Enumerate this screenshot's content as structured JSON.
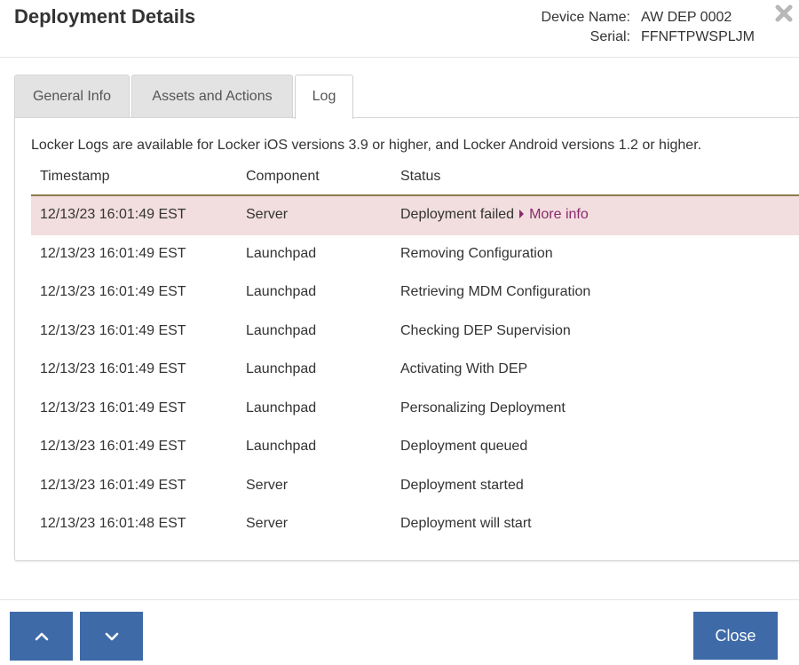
{
  "dialog": {
    "title": "Deployment Details",
    "device_name_label": "Device Name:",
    "device_name": "AW DEP 0002",
    "serial_label": "Serial:",
    "serial": "FFNFTPWSPLJM",
    "close_icon": "close-x-icon"
  },
  "tabs": [
    {
      "label": "General Info",
      "active": false
    },
    {
      "label": "Assets and Actions",
      "active": false
    },
    {
      "label": "Log",
      "active": true
    }
  ],
  "log": {
    "note": "Locker Logs are available for Locker iOS versions 3.9 or higher, and Locker Android versions 1.2 or higher.",
    "columns": [
      "Timestamp",
      "Component",
      "Status"
    ],
    "rows": [
      {
        "timestamp": "12/13/23 16:01:49 EST",
        "component": "Server",
        "status": "Deployment failed",
        "more": "More info",
        "error": true
      },
      {
        "timestamp": "12/13/23 16:01:49 EST",
        "component": "Launchpad",
        "status": "Removing Configuration"
      },
      {
        "timestamp": "12/13/23 16:01:49 EST",
        "component": "Launchpad",
        "status": "Retrieving MDM Configuration"
      },
      {
        "timestamp": "12/13/23 16:01:49 EST",
        "component": "Launchpad",
        "status": "Checking DEP Supervision"
      },
      {
        "timestamp": "12/13/23 16:01:49 EST",
        "component": "Launchpad",
        "status": "Activating With DEP"
      },
      {
        "timestamp": "12/13/23 16:01:49 EST",
        "component": "Launchpad",
        "status": "Personalizing Deployment"
      },
      {
        "timestamp": "12/13/23 16:01:49 EST",
        "component": "Launchpad",
        "status": "Deployment queued"
      },
      {
        "timestamp": "12/13/23 16:01:49 EST",
        "component": "Server",
        "status": "Deployment started"
      },
      {
        "timestamp": "12/13/23 16:01:48 EST",
        "component": "Server",
        "status": "Deployment will start"
      }
    ]
  },
  "footer": {
    "prev_icon": "chevron-up-icon",
    "next_icon": "chevron-down-icon",
    "close_label": "Close"
  },
  "colors": {
    "accent": "#3e6aa8",
    "error_row": "#f2dede",
    "link": "#8a2a6d",
    "header_rule": "#8d7a4b"
  }
}
